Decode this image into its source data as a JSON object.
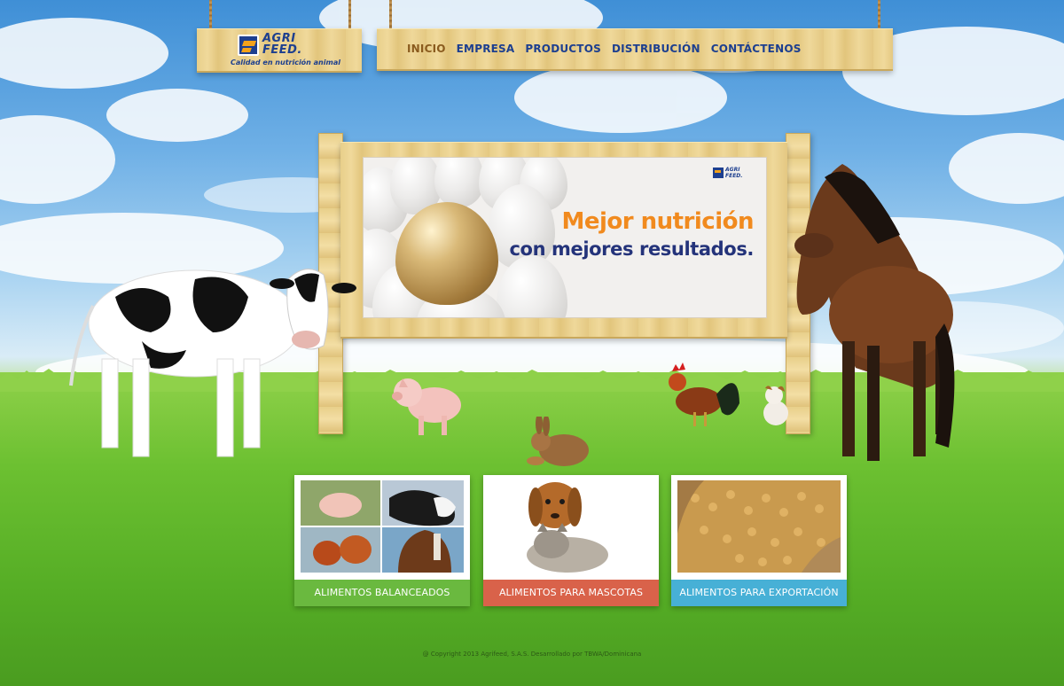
{
  "brand": {
    "name_line1": "AGRI",
    "name_line2": "FEED.",
    "tagline": "Calidad en nutrición animal"
  },
  "nav": {
    "items": [
      {
        "label": "INICIO",
        "active": true
      },
      {
        "label": "EMPRESA",
        "active": false
      },
      {
        "label": "PRODUCTOS",
        "active": false
      },
      {
        "label": "DISTRIBUCIÓN",
        "active": false
      },
      {
        "label": "CONTÁCTENOS",
        "active": false
      }
    ]
  },
  "banner": {
    "logo_line1": "AGRI",
    "logo_line2": "FEED.",
    "headline_1": "Mejor nutrición",
    "headline_2": "con mejores resultados."
  },
  "cards": [
    {
      "label": "ALIMENTOS BALANCEADOS",
      "color": "#6ab93f",
      "image": "farm-animals-collage"
    },
    {
      "label": "ALIMENTOS PARA MASCOTAS",
      "color": "#d9624a",
      "image": "dog-and-cat"
    },
    {
      "label": "ALIMENTOS PARA EXPORTACIÓN",
      "color": "#47b0d6",
      "image": "feed-pellets-sack"
    }
  ],
  "footer": {
    "copyright": "@ Copyright 2013 Agrifeed, S.A.S. Desarrollado por TBWA/Dominicana"
  },
  "colors": {
    "brand_blue": "#1d3f8f",
    "brand_orange": "#f18a1e",
    "headline_navy": "#24337a"
  }
}
